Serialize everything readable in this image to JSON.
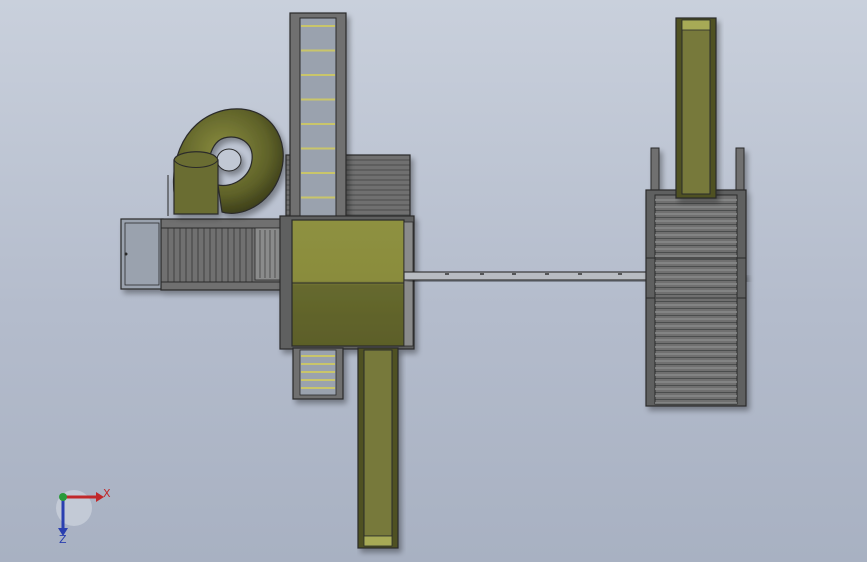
{
  "colors": {
    "background_top": "#c9d0dc",
    "background_bottom": "#a8b1c2",
    "outline": "#2b2b2b",
    "deck_olive_light": "#8e9140",
    "deck_olive_dark": "#66692e",
    "slide_olive": "#77793a",
    "slide_rail": "#a7aa57",
    "wood_gray": "#6f7070",
    "wood_gray_light": "#8a8b8b",
    "rung_yellow": "#c9c56a",
    "axis_x": "#c0282a",
    "axis_y": "#2a9a3a",
    "axis_z": "#2a3fb0"
  },
  "axes": {
    "x_label": "X",
    "z_label": "Z"
  }
}
